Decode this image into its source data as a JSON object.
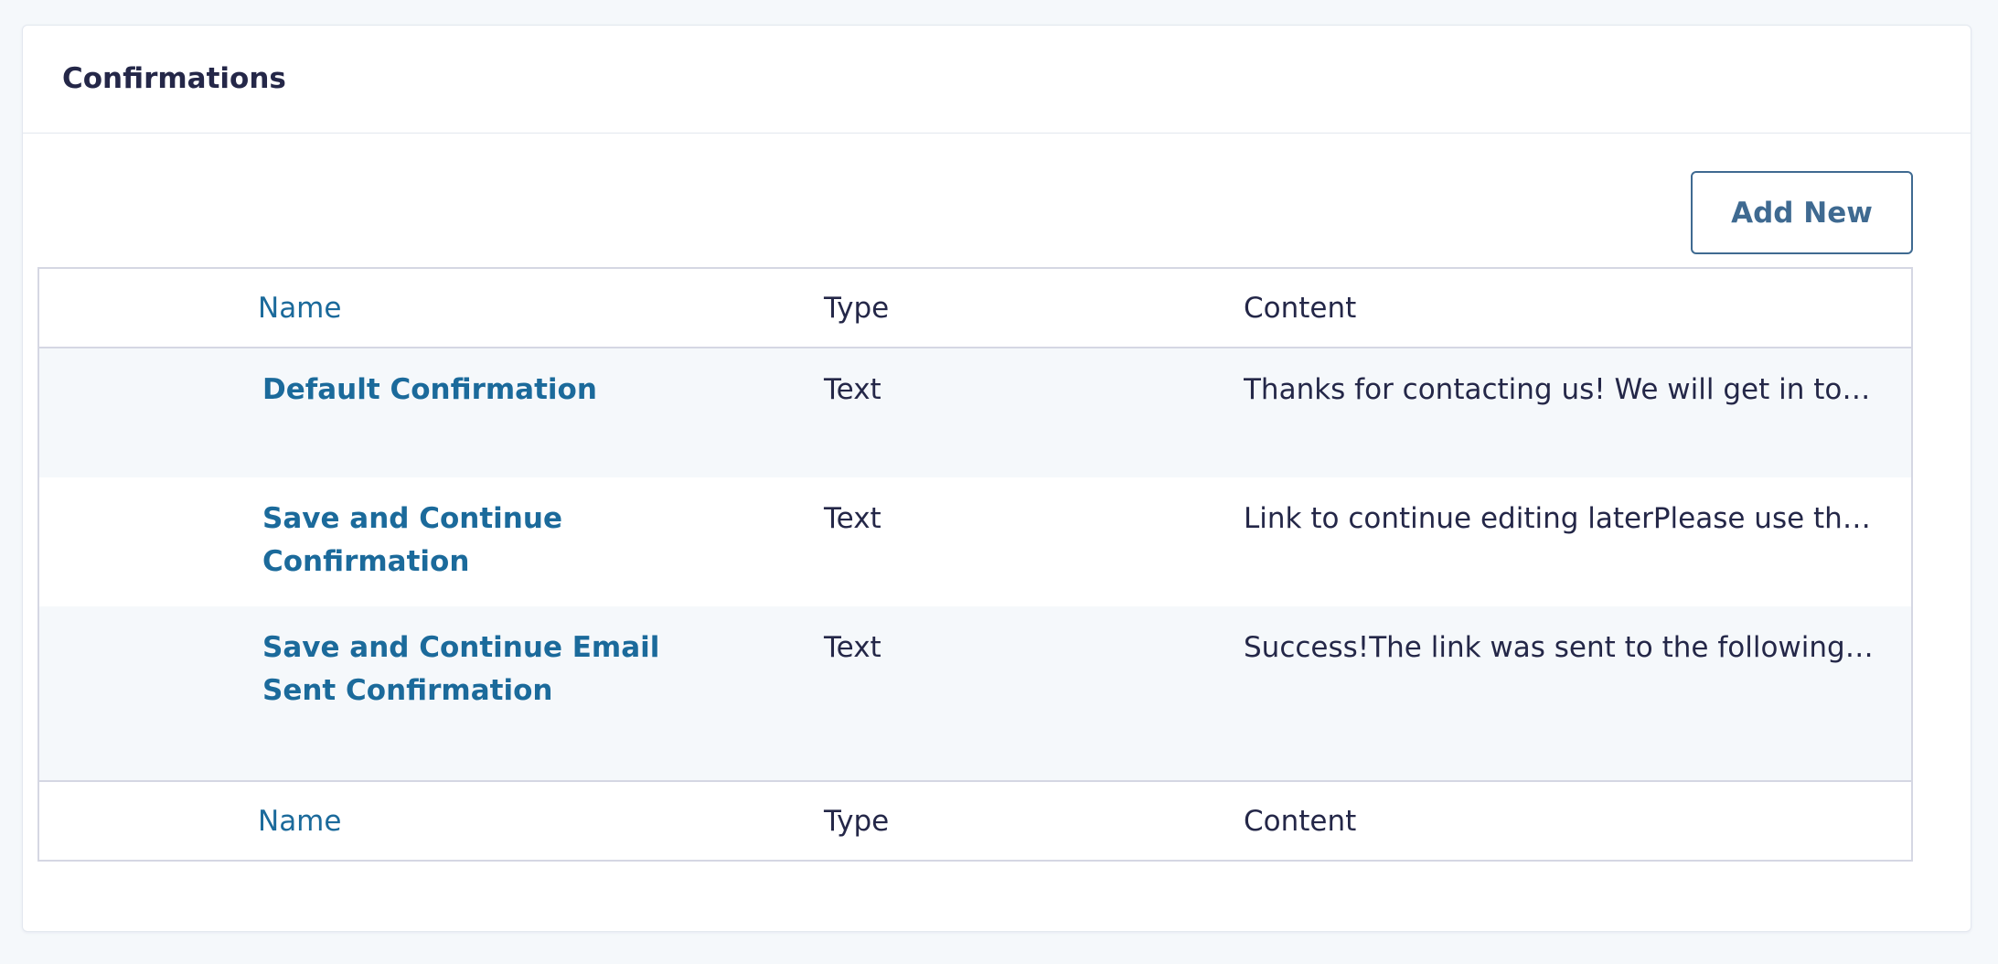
{
  "panel": {
    "title": "Confirmations",
    "add_new_label": "Add New"
  },
  "table": {
    "columns": {
      "name": "Name",
      "type": "Type",
      "content": "Content"
    },
    "rows": [
      {
        "name": "Default Confirmation",
        "type": "Text",
        "content": "Thanks for contacting us! We will get in touch w..."
      },
      {
        "name": "Save and Continue Confirmation",
        "type": "Text",
        "content": "Link to continue editing laterPlease use the follo..."
      },
      {
        "name": "Save and Continue Email Sent Confirmation",
        "type": "Text",
        "content": "Success!The link was sent to the following email..."
      }
    ]
  },
  "colors": {
    "link": "#1b6a9b",
    "button": "#3f6a91",
    "text": "#242748",
    "row_alt": "#f5f8fb"
  }
}
